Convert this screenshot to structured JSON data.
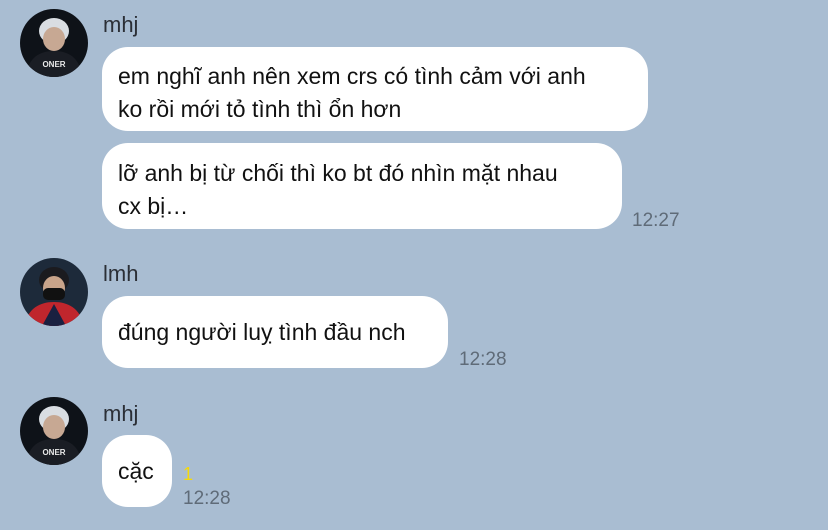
{
  "messages": [
    {
      "sender": "mhj",
      "avatar_icon": "player-portrait-oner-icon",
      "bubbles": [
        "em nghĩ anh nên xem crs có tình cảm với anh\nko rồi mới tỏ tình thì ổn hơn",
        "lỡ anh bị từ chối thì ko bt đó nhìn mặt nhau\ncx bị…"
      ],
      "time": "12:27"
    },
    {
      "sender": "lmh",
      "avatar_icon": "player-portrait-masked-icon",
      "bubbles": [
        "đúng người luỵ tình đầu nch"
      ],
      "time": "12:28"
    },
    {
      "sender": "mhj",
      "avatar_icon": "player-portrait-oner-icon",
      "bubbles": [
        "cặc"
      ],
      "unread": "1",
      "time": "12:28"
    }
  ],
  "avatar_jersey_text": "ONER",
  "colors": {
    "background": "#a9bdd2",
    "bubble": "#ffffff",
    "timestamp": "#5f6b78",
    "unread": "#f5d90a"
  }
}
